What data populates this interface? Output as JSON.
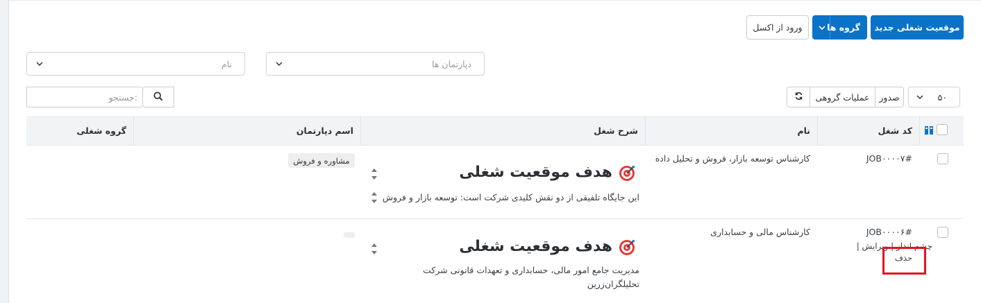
{
  "toolbar": {
    "new_position_label": "موقعیت شغلی جدید",
    "groups_label": "گروه ها",
    "excel_import_label": "ورود از اکسل"
  },
  "filters": {
    "departments_placeholder": "دپارتمان ها",
    "name_placeholder": "نام"
  },
  "table_controls": {
    "page_size": "۵۰",
    "export_label": "صدور",
    "bulk_actions_label": "عملیات گروهی",
    "search_placeholder": "جستجو:"
  },
  "table": {
    "headers": {
      "code": "کد شغل",
      "name": "نام",
      "description": "شرح شغل",
      "department": "اسم دپارتمان",
      "group": "گروه شغلی"
    },
    "rows": [
      {
        "code": "#JOB۰۰۰۰۷",
        "name": "کارشناس توسعه بازار، فروش و تحلیل داده",
        "description_title": "هدف موقعیت شغلی",
        "description_text": "این جایگاه تلفیقی از دو نقش کلیدی شرکت است: توسعه بازار و فروش",
        "department": "مشاوره و فروش",
        "group": ""
      },
      {
        "code": "#JOB۰۰۰۰۶",
        "name": "کارشناس مالی و حسابداری",
        "row_actions": "چشم انداز | ویرایش |",
        "delete_label": "حذف",
        "description_title": "هدف موقعیت شغلی",
        "description_line1": "مدیریت جامع امور مالی، حسابداری و تعهدات قانونی شرکت",
        "description_line2": "تحلیلگران‌زرین",
        "department": "",
        "group": ""
      }
    ]
  },
  "colors": {
    "primary": "#0a73c8",
    "highlight_box": "#e0141e"
  }
}
